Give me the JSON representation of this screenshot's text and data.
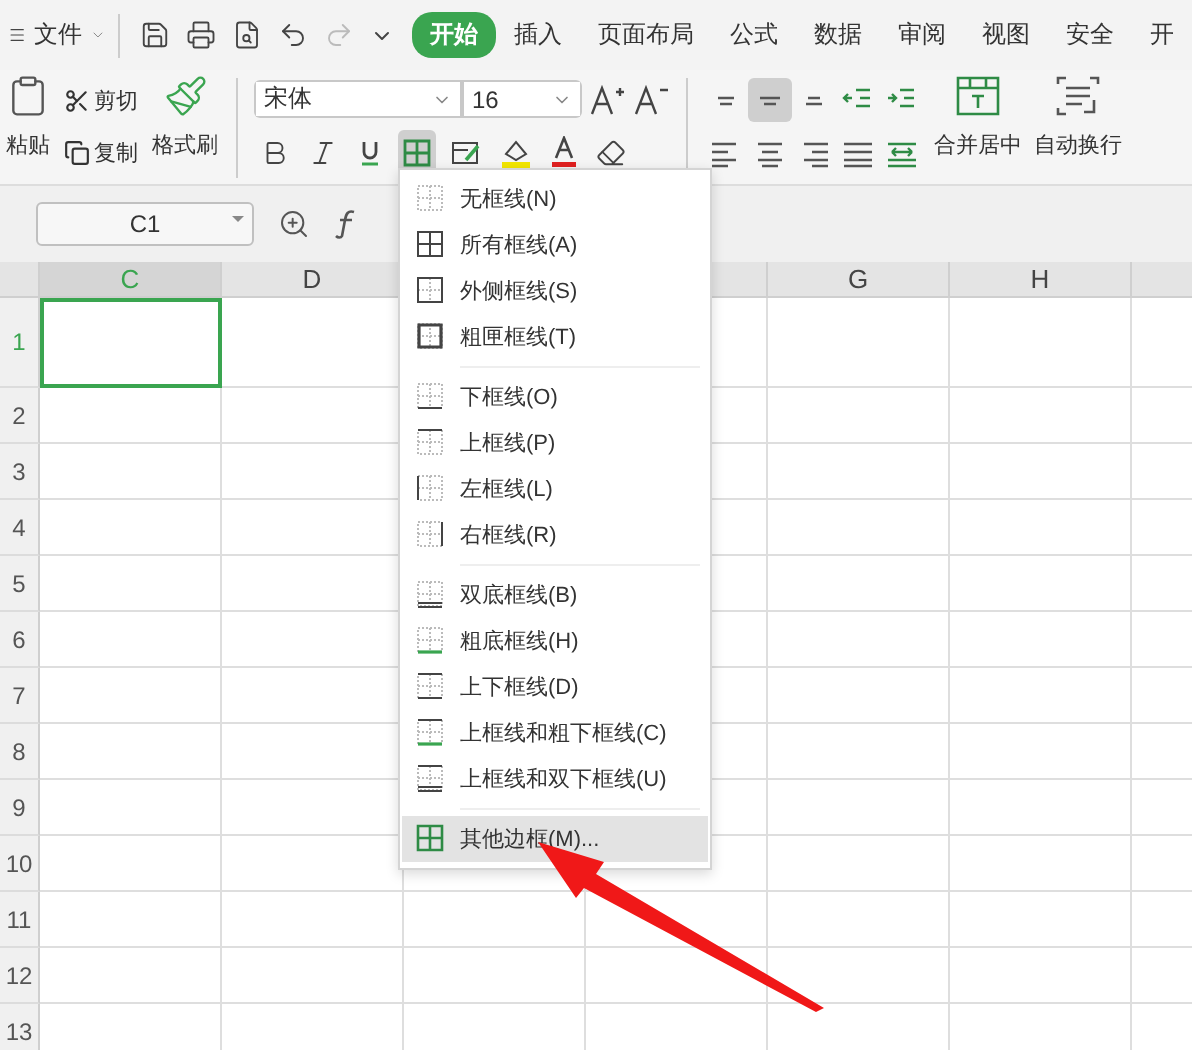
{
  "menu_bar": {
    "file_label": "文件",
    "tabs": [
      {
        "label": "开始",
        "selected": true
      },
      {
        "label": "插入",
        "selected": false
      },
      {
        "label": "页面布局",
        "selected": false
      },
      {
        "label": "公式",
        "selected": false
      },
      {
        "label": "数据",
        "selected": false
      },
      {
        "label": "审阅",
        "selected": false
      },
      {
        "label": "视图",
        "selected": false
      },
      {
        "label": "安全",
        "selected": false
      },
      {
        "label": "开",
        "selected": false
      }
    ]
  },
  "ribbon": {
    "paste": "粘贴",
    "cut": "剪切",
    "copy": "复制",
    "format_painter": "格式刷",
    "font_name": "宋体",
    "font_size": "16",
    "format_buttons": [
      {
        "kind": "bold",
        "pressed": false
      },
      {
        "kind": "italic",
        "pressed": false
      },
      {
        "kind": "underline",
        "pressed": false
      },
      {
        "kind": "border",
        "pressed": true
      },
      {
        "kind": "cell-style",
        "pressed": false
      },
      {
        "kind": "fill",
        "pressed": false
      },
      {
        "kind": "font-color",
        "pressed": false
      },
      {
        "kind": "eraser",
        "pressed": false
      }
    ],
    "align_buttons": [
      {
        "kind": "top",
        "pressed": false
      },
      {
        "kind": "middle",
        "pressed": true
      },
      {
        "kind": "bottom",
        "pressed": false
      },
      {
        "kind": "outdent",
        "pressed": false
      },
      {
        "kind": "indent",
        "pressed": false
      },
      {
        "kind": "left",
        "pressed": false
      },
      {
        "kind": "center",
        "pressed": false
      },
      {
        "kind": "right",
        "pressed": false
      },
      {
        "kind": "justify",
        "pressed": false
      },
      {
        "kind": "distribute",
        "pressed": false
      }
    ],
    "merge_label": "合并居中",
    "wrap_label": "自动换行"
  },
  "formula_bar": {
    "name_box": "C1"
  },
  "sheet": {
    "columns": [
      {
        "label": "C",
        "selected": true
      },
      {
        "label": "D",
        "selected": false
      },
      {
        "label": "G",
        "selected": false
      },
      {
        "label": "H",
        "selected": false
      }
    ],
    "rows": [
      {
        "label": "1",
        "selected": true
      },
      {
        "label": "2",
        "selected": false
      },
      {
        "label": "3",
        "selected": false
      },
      {
        "label": "4",
        "selected": false
      },
      {
        "label": "5",
        "selected": false
      },
      {
        "label": "6",
        "selected": false
      },
      {
        "label": "7",
        "selected": false
      },
      {
        "label": "8",
        "selected": false
      },
      {
        "label": "9",
        "selected": false
      },
      {
        "label": "10",
        "selected": false
      },
      {
        "label": "11",
        "selected": false
      },
      {
        "label": "12",
        "selected": false
      },
      {
        "label": "13",
        "selected": false
      }
    ]
  },
  "border_menu": {
    "items": [
      {
        "label": "无框线(N)",
        "kind": "none",
        "selected": false
      },
      {
        "label": "所有框线(A)",
        "kind": "all",
        "selected": false
      },
      {
        "label": "外侧框线(S)",
        "kind": "outside",
        "selected": false
      },
      {
        "label": "粗匣框线(T)",
        "kind": "thick-box",
        "selected": false
      },
      {
        "kind": "separator"
      },
      {
        "label": "下框线(O)",
        "kind": "bottom",
        "selected": false
      },
      {
        "label": "上框线(P)",
        "kind": "top",
        "selected": false
      },
      {
        "label": "左框线(L)",
        "kind": "left",
        "selected": false
      },
      {
        "label": "右框线(R)",
        "kind": "right",
        "selected": false
      },
      {
        "kind": "separator"
      },
      {
        "label": "双底框线(B)",
        "kind": "double-bottom",
        "selected": false
      },
      {
        "label": "粗底框线(H)",
        "kind": "thick-bottom",
        "selected": false
      },
      {
        "label": "上下框线(D)",
        "kind": "top-bottom",
        "selected": false
      },
      {
        "label": "上框线和粗下框线(C)",
        "kind": "top-thick-bottom",
        "selected": false
      },
      {
        "label": "上框线和双下框线(U)",
        "kind": "top-double-bottom",
        "selected": false
      },
      {
        "kind": "separator"
      },
      {
        "label": "其他边框(M)...",
        "kind": "more",
        "selected": true
      }
    ]
  }
}
